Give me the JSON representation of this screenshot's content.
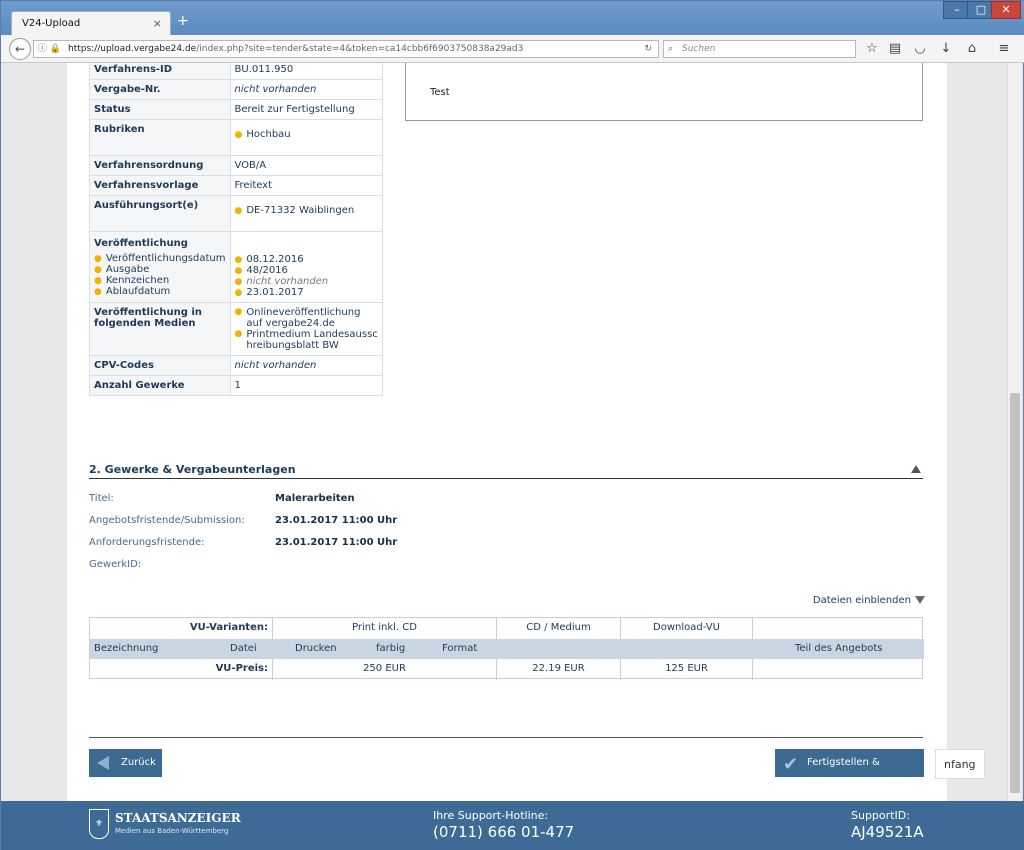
{
  "browser": {
    "tab_title": "V24-Upload",
    "tab_close": "×",
    "new_tab": "+",
    "url_host": "https://upload.vergabe24.de",
    "url_path": "/index.php?site=tender&state=4&token=ca14cbb6f6903750838a29ad3",
    "search_placeholder": "Suchen",
    "icons": [
      "back-icon",
      "info-icon",
      "lock-icon",
      "reload-icon",
      "search-icon",
      "star-icon",
      "reading-list-icon",
      "pocket-icon",
      "download-icon",
      "home-icon",
      "menu-icon"
    ],
    "window_buttons": [
      "–",
      "□",
      "✕"
    ]
  },
  "details": {
    "rows": [
      {
        "key": "Verfahrens-ID",
        "value": "BU.011.950"
      },
      {
        "key": "Vergabe-Nr.",
        "value": "nicht vorhanden"
      },
      {
        "key": "Status",
        "value": "Bereit zur Fertigstellung"
      },
      {
        "key": "Rubriken",
        "value": "Hochbau"
      },
      {
        "key": "Verfahrensordnung",
        "value": "VOB/A"
      },
      {
        "key": "Verfahrensvorlage",
        "value": "Freitext"
      },
      {
        "key": "Ausführungsort(e)",
        "value": "DE-71332 Waiblingen"
      }
    ],
    "veroeff_title": "Veröffentlichung",
    "veroeff": [
      {
        "key": "Veröffentlichungsdatum",
        "value": "08.12.2016"
      },
      {
        "key": "Ausgabe",
        "value": "48/2016"
      },
      {
        "key": "Kennzeichen",
        "value": "nicht vorhanden"
      },
      {
        "key": "Ablaufdatum",
        "value": "23.01.2017"
      }
    ],
    "medien_key": "Veröffentlichung in folgenden Medien",
    "medien": [
      "Onlineveröffentlichung auf vergabe24.de",
      "Printmedium Landesausschreibungsblatt BW"
    ],
    "cpv_key": "CPV-Codes",
    "cpv_value": "nicht vorhanden",
    "anzahl_key": "Anzahl Gewerke",
    "anzahl_value": "1"
  },
  "right_box": {
    "text": "Test"
  },
  "section2": {
    "title": "2. Gewerke & Vergabeunterlagen",
    "fields": [
      {
        "label": "Titel:",
        "value": "Malerarbeiten"
      },
      {
        "label": "Angebotsfristende/Submission:",
        "value": "23.01.2017 11:00 Uhr"
      },
      {
        "label": "Anforderungsfristende:",
        "value": "23.01.2017 11:00 Uhr"
      },
      {
        "label": "GewerkID:",
        "value": ""
      }
    ],
    "dateien_toggle": "Dateien einblenden"
  },
  "vu_table": {
    "varianten_label": "VU-Varianten:",
    "variants": [
      "Print inkl. CD",
      "CD / Medium",
      "Download-VU"
    ],
    "columns": [
      "Bezeichnung",
      "Datei",
      "Drucken",
      "farbig",
      "Format",
      "Teil des Angebots"
    ],
    "preis_label": "VU-Preis:",
    "prices": [
      "250 EUR",
      "22.19 EUR",
      "125 EUR"
    ]
  },
  "actions": {
    "back": "Zurück",
    "finish": "Fertigstellen & Freigeben",
    "ghost": "nfang"
  },
  "footer": {
    "brand": "STAATSANZEIGER",
    "brand_sub": "Medien aus Baden-Württemberg",
    "hotline_label": "Ihre Support-Hotline:",
    "hotline": "(0711) 666 01-477",
    "support_label": "SupportID:",
    "support_id": "AJ49521A"
  },
  "colors": {
    "footer": "#3d6b95",
    "button": "#3c6a92",
    "bullet": "#f0b400",
    "table_header": "#c9d5e2"
  }
}
